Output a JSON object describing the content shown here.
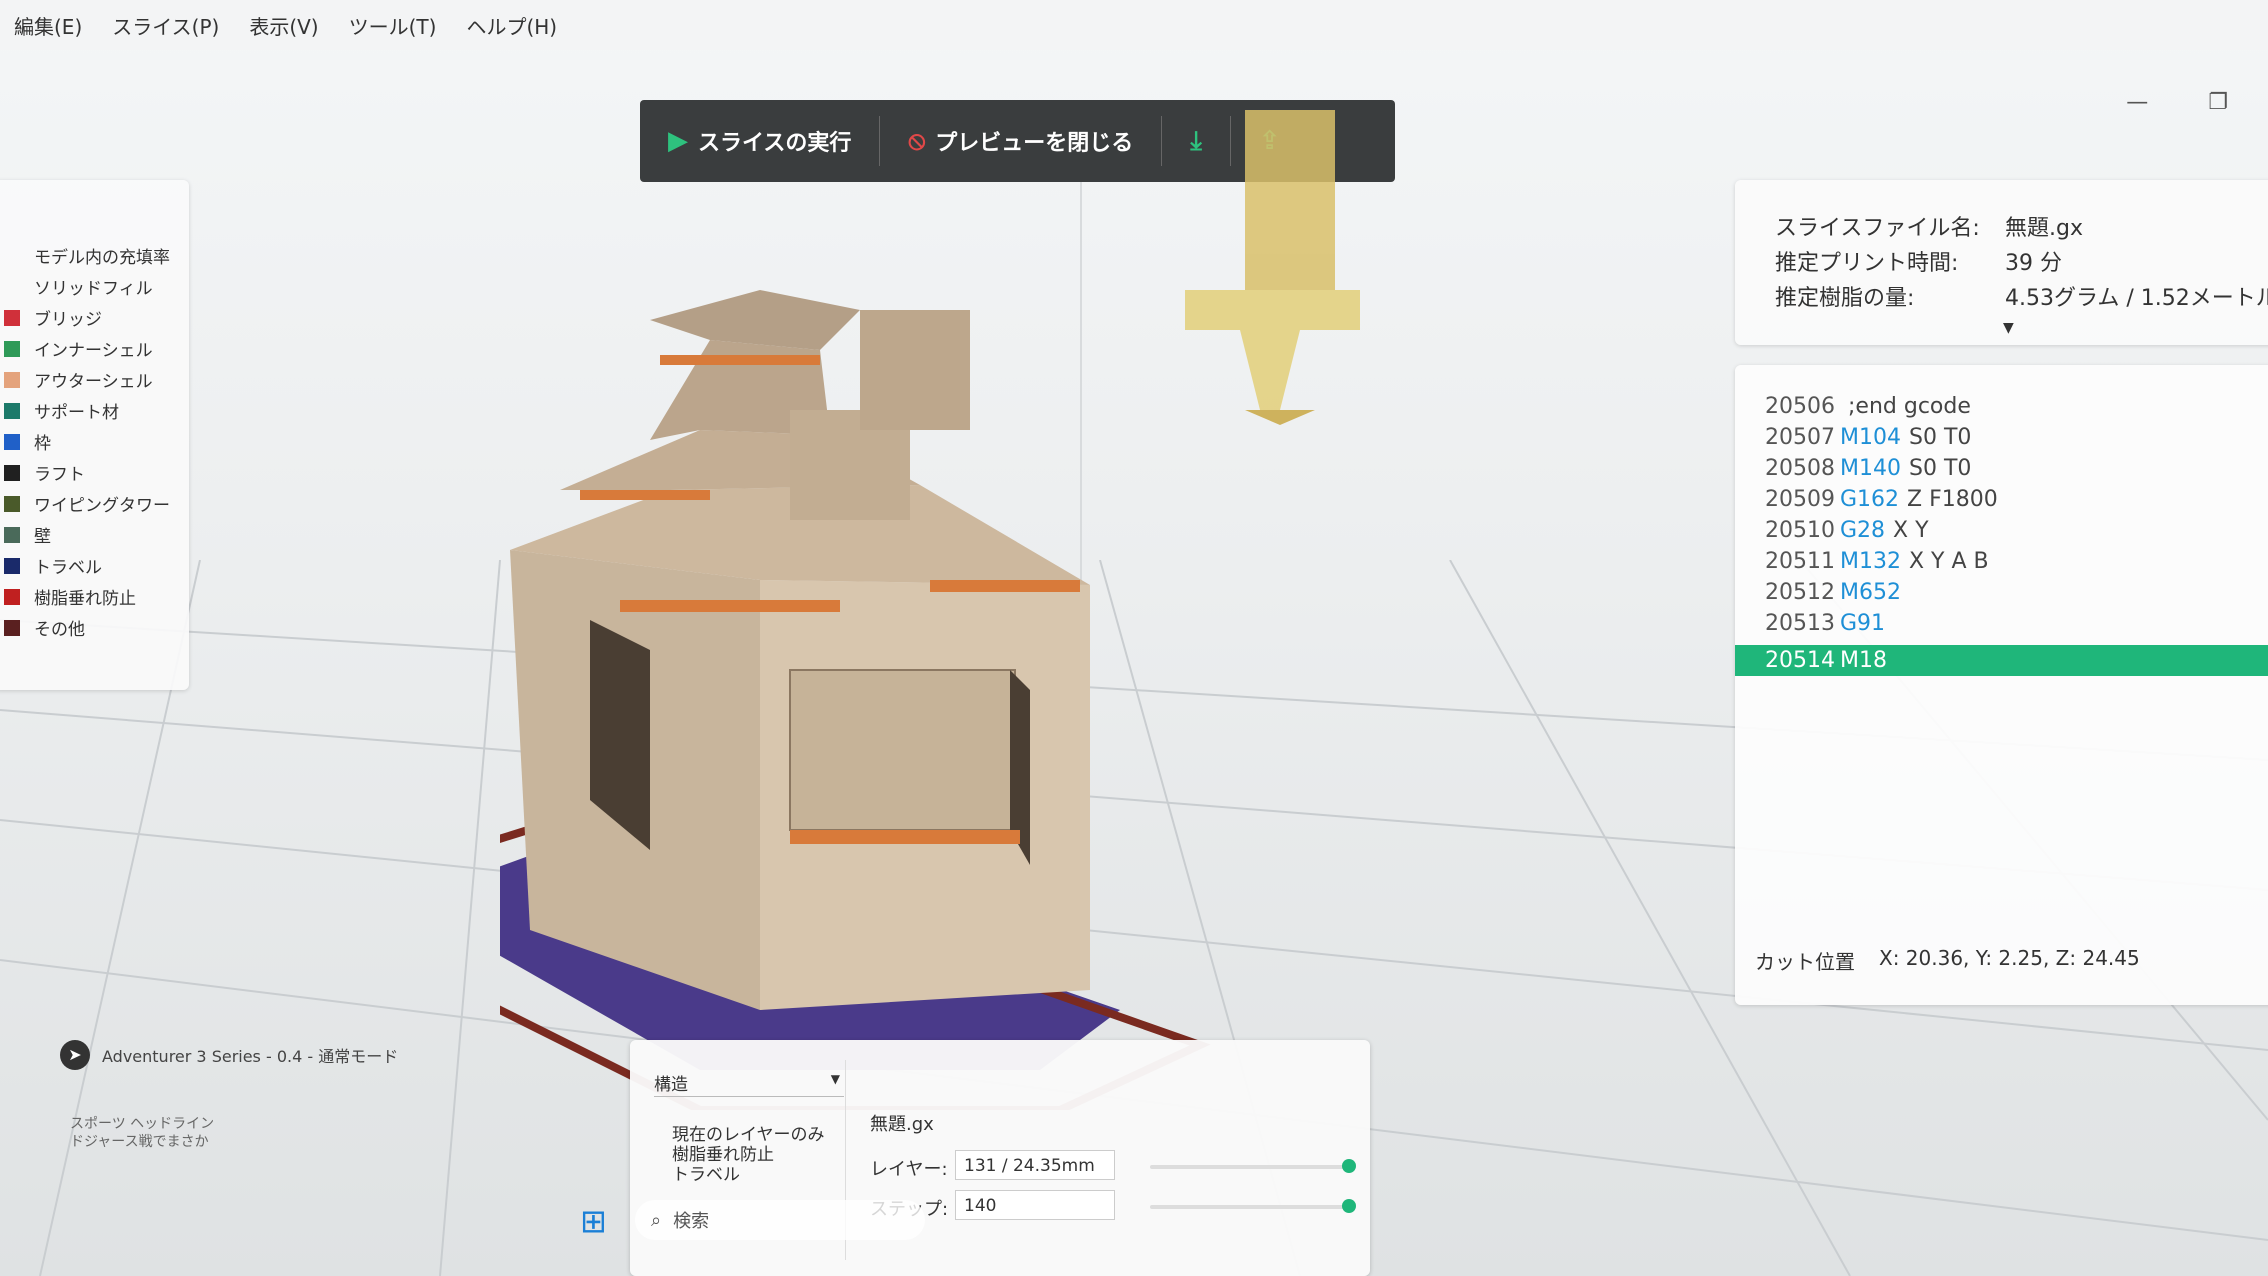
{
  "menu": [
    "編集(E)",
    "スライス(P)",
    "表示(V)",
    "ツール(T)",
    "ヘルプ(H)"
  ],
  "toolbar": {
    "run_slice": "スライスの実行",
    "close_preview": "プレビューを閉じる"
  },
  "legend": [
    {
      "label": "モデル内の充填率",
      "color": ""
    },
    {
      "label": "ソリッドフィル",
      "color": ""
    },
    {
      "label": "ブリッジ",
      "color": "#d0303a"
    },
    {
      "label": "インナーシェル",
      "color": "#2f9a58"
    },
    {
      "label": "アウターシェル",
      "color": "#e4a37c"
    },
    {
      "label": "サポート材",
      "color": "#1d7a6a"
    },
    {
      "label": "枠",
      "color": "#2060c8"
    },
    {
      "label": "ラフト",
      "color": "#202020"
    },
    {
      "label": "ワイピングタワー",
      "color": "#4a5a2a"
    },
    {
      "label": "壁",
      "color": "#4a6a5a"
    },
    {
      "label": "トラベル",
      "color": "#1a2a6a"
    },
    {
      "label": "樹脂垂れ防止",
      "color": "#c02020"
    },
    {
      "label": "その他",
      "color": "#5a2020"
    }
  ],
  "info": {
    "file_label": "スライスファイル名:",
    "file_value": "無題.gx",
    "time_label": "推定プリント時間:",
    "time_value": "39 分",
    "resin_label": "推定樹脂の量:",
    "resin_value": "4.53グラム / 1.52メートル"
  },
  "gcode": [
    {
      "num": "20506",
      "cmd": "",
      "args": ";end gcode"
    },
    {
      "num": "20507",
      "cmd": "M104",
      "args": "S0 T0"
    },
    {
      "num": "20508",
      "cmd": "M140",
      "args": "S0 T0"
    },
    {
      "num": "20509",
      "cmd": "G162",
      "args": "Z F1800"
    },
    {
      "num": "20510",
      "cmd": "G28",
      "args": "X Y"
    },
    {
      "num": "20511",
      "cmd": "M132",
      "args": "X Y A B"
    },
    {
      "num": "20512",
      "cmd": "M652",
      "args": ""
    },
    {
      "num": "20513",
      "cmd": "G91",
      "args": ""
    },
    {
      "num": "20514",
      "cmd": "M18",
      "args": ""
    }
  ],
  "cut": {
    "label": "カット位置",
    "value": "X: 20.36, Y: 2.25, Z: 24.45"
  },
  "layer_panel": {
    "structure": "構造",
    "opt_current": "現在のレイヤーのみ",
    "opt_drip": "樹脂垂れ防止",
    "opt_travel": "トラベル",
    "filename": "無題.gx",
    "layer_label": "レイヤー:",
    "layer_value": "131 / 24.35mm",
    "step_label": "ステップ:",
    "step_value": "140"
  },
  "printer": "Adventurer 3 Series - 0.4 - 通常モード",
  "notice": [
    "スポーツ ヘッドライン",
    "ドジャース戦でまさか"
  ],
  "taskbar": {
    "search": "検索"
  }
}
